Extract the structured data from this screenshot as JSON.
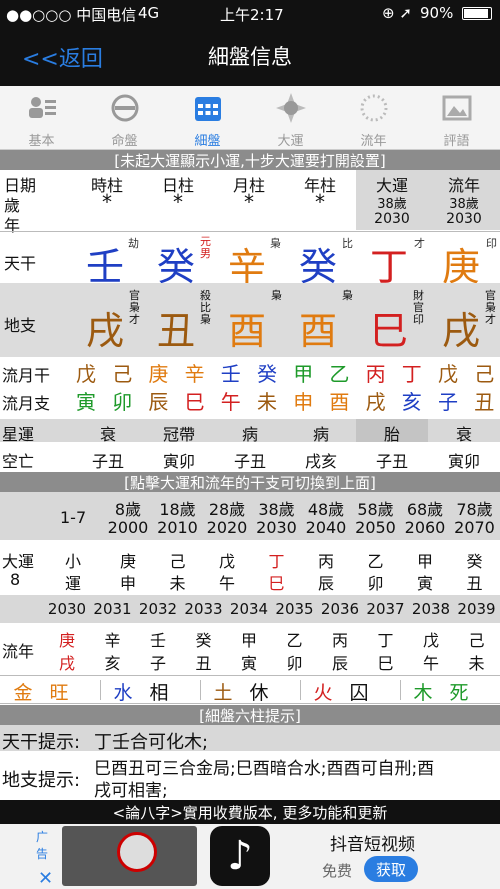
{
  "status": {
    "carrier": "●●○○○ 中国电信",
    "network": "4G",
    "time": "上午2:17",
    "battery": "90%"
  },
  "nav": {
    "back": "<<返回",
    "title": "細盤信息"
  },
  "tabs": [
    {
      "label": "基本",
      "icon": "person-card-icon"
    },
    {
      "label": "命盤",
      "icon": "compass-icon"
    },
    {
      "label": "細盤",
      "icon": "calendar-icon"
    },
    {
      "label": "大運",
      "icon": "sun-icon"
    },
    {
      "label": "流年",
      "icon": "dotted-circle-icon"
    },
    {
      "label": "評語",
      "icon": "picture-icon"
    }
  ],
  "notice1": "[未起大運顯示小運,十步大運要打開設置]",
  "header": {
    "date": "日期",
    "age1": "歲",
    "age2": "年",
    "cols": [
      "時柱",
      "日柱",
      "月柱",
      "年柱",
      "大運",
      "流年"
    ],
    "stars": [
      "*",
      "*",
      "*",
      "*"
    ],
    "dayun_age": "38歲",
    "dayun_year": "2030",
    "liunian_age": "38歲",
    "liunian_year": "2030"
  },
  "tiangan": {
    "label": "天干",
    "chars": [
      "壬",
      "癸",
      "辛",
      "癸",
      "丁",
      "庚"
    ],
    "notes": [
      "劫",
      "元男",
      "梟",
      "比",
      "才",
      "印"
    ]
  },
  "dizhi": {
    "label": "地支",
    "chars": [
      "戌",
      "丑",
      "酉",
      "酉",
      "巳",
      "戌"
    ],
    "notes": [
      "官梟才",
      "殺比梟",
      "梟",
      "梟",
      "財官印",
      "官梟才"
    ]
  },
  "liuyue": {
    "label_gan": "流月干",
    "label_zhi": "流月支",
    "gan": [
      "戊",
      "己",
      "庚",
      "辛",
      "壬",
      "癸",
      "甲",
      "乙",
      "丙",
      "丁",
      "戊",
      "己"
    ],
    "zhi": [
      "寅",
      "卯",
      "辰",
      "巳",
      "午",
      "未",
      "申",
      "酉",
      "戌",
      "亥",
      "子",
      "丑"
    ]
  },
  "xingyun": {
    "label": "星運",
    "vals": [
      "衰",
      "冠帶",
      "病",
      "病",
      "胎",
      "衰"
    ]
  },
  "kongwang": {
    "label": "空亡",
    "vals": [
      "子丑",
      "寅卯",
      "子丑",
      "戌亥",
      "子丑",
      "寅卯"
    ]
  },
  "notice2": "[點擊大運和流年的干支可切換到上面]",
  "dayun_ages": {
    "first": "1-7",
    "ages": [
      "8歲",
      "18歲",
      "28歲",
      "38歲",
      "48歲",
      "58歲",
      "68歲",
      "78歲"
    ],
    "years": [
      "2000",
      "2010",
      "2020",
      "2030",
      "2040",
      "2050",
      "2060",
      "2070"
    ]
  },
  "dayun": {
    "label": "大運",
    "num": "8",
    "first": [
      "小",
      "運"
    ],
    "gan": [
      "庚",
      "己",
      "戊",
      "丁",
      "丙",
      "乙",
      "甲",
      "癸"
    ],
    "zhi": [
      "申",
      "未",
      "午",
      "巳",
      "辰",
      "卯",
      "寅",
      "丑"
    ]
  },
  "liunian": {
    "label": "流年",
    "years": [
      "2030",
      "2031",
      "2032",
      "2033",
      "2034",
      "2035",
      "2036",
      "2037",
      "2038",
      "2039"
    ],
    "gan": [
      "庚",
      "辛",
      "壬",
      "癸",
      "甲",
      "乙",
      "丙",
      "丁",
      "戊",
      "己"
    ],
    "zhi": [
      "戌",
      "亥",
      "子",
      "丑",
      "寅",
      "卯",
      "辰",
      "巳",
      "午",
      "未"
    ]
  },
  "wuxing": [
    {
      "el": "金",
      "st": "旺",
      "color": "#e07b10"
    },
    {
      "el": "水",
      "st": "相",
      "color": "#1f3fc4"
    },
    {
      "el": "土",
      "st": "休",
      "color": "#9c5a10"
    },
    {
      "el": "火",
      "st": "囚",
      "color": "#d32020"
    },
    {
      "el": "木",
      "st": "死",
      "color": "#1e9a2a"
    }
  ],
  "notice3": "[細盤六柱提示]",
  "tips": {
    "gan_label": "天干提示:",
    "gan_text": "丁壬合可化木;",
    "zhi_label": "地支提示:",
    "zhi_text1": "巳酉丑可三合金局;巳酉暗合水;酉酉可自刑;酉",
    "zhi_text2": "戌可相害;"
  },
  "footer": "<論八字>實用收費版本, 更多功能和更新",
  "ad": {
    "tag": "广告",
    "title": "抖音短视频",
    "free": "免费",
    "button": "获取"
  },
  "colors": {
    "accent": "#2a7de1",
    "navbar": "#111111",
    "section": "#8c8c8c"
  }
}
